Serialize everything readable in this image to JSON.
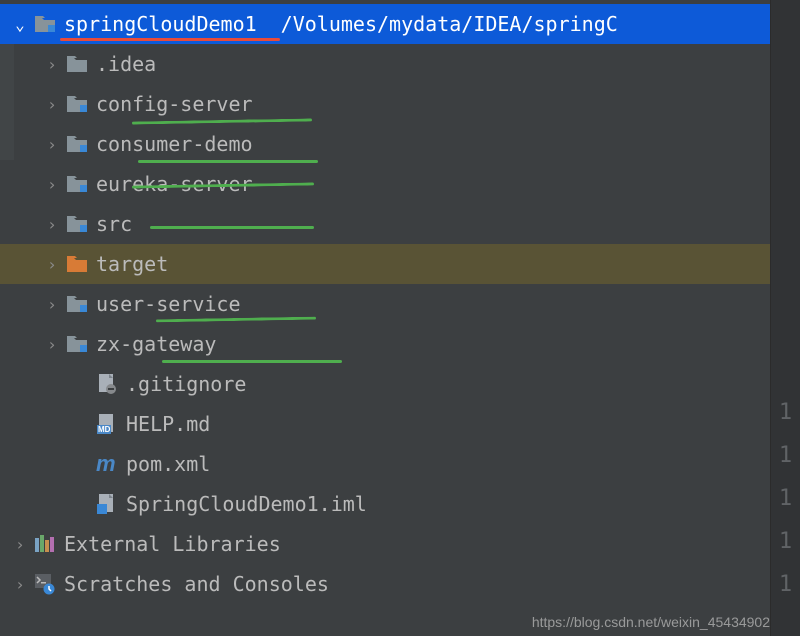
{
  "root": {
    "name": "springCloudDemo1",
    "path": "/Volumes/mydata/IDEA/springC",
    "expanded": true
  },
  "children": [
    {
      "name": ".idea",
      "type": "folder",
      "expandable": true,
      "icon": "folder"
    },
    {
      "name": "config-server",
      "type": "module",
      "expandable": true,
      "icon": "module-folder"
    },
    {
      "name": "consumer-demo",
      "type": "module",
      "expandable": true,
      "icon": "module-folder"
    },
    {
      "name": "eureka-server",
      "type": "module",
      "expandable": true,
      "icon": "module-folder"
    },
    {
      "name": "src",
      "type": "folder",
      "expandable": true,
      "icon": "module-folder"
    },
    {
      "name": "target",
      "type": "target-folder",
      "expandable": true,
      "icon": "target-folder",
      "highlighted": true
    },
    {
      "name": "user-service",
      "type": "module",
      "expandable": true,
      "icon": "module-folder"
    },
    {
      "name": "zx-gateway",
      "type": "module",
      "expandable": true,
      "icon": "module-folder"
    },
    {
      "name": ".gitignore",
      "type": "file",
      "expandable": false,
      "icon": "gitignore-file"
    },
    {
      "name": "HELP.md",
      "type": "file",
      "expandable": false,
      "icon": "md-file"
    },
    {
      "name": "pom.xml",
      "type": "file",
      "expandable": false,
      "icon": "maven-file"
    },
    {
      "name": "SpringCloudDemo1.iml",
      "type": "file",
      "expandable": false,
      "icon": "iml-file"
    }
  ],
  "siblings": [
    {
      "name": "External Libraries",
      "icon": "libraries",
      "expandable": true
    },
    {
      "name": "Scratches and Consoles",
      "icon": "scratches",
      "expandable": true
    }
  ],
  "gutter": [
    "1",
    "1",
    "1",
    "1",
    "1"
  ],
  "watermark": "https://blog.csdn.net/weixin_45434902"
}
